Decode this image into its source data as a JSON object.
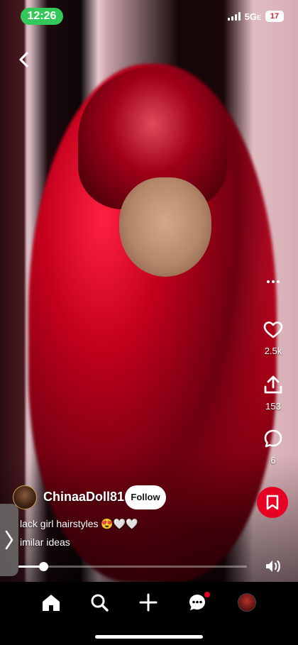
{
  "status_bar": {
    "time": "12:26",
    "network": "5G",
    "network_suffix": "E",
    "battery": "17",
    "time_color": "#34c759"
  },
  "pin": {
    "creator_name": "ChinaaDoll81",
    "follow_label": "Follow",
    "caption": "lack girl hairstyles 😍🤍🤍",
    "similar_ideas_label": "imilar ideas",
    "likes_count": "2.5k",
    "shares_count": "153",
    "comments_count": "6",
    "video_progress": 0.11
  },
  "icons": {
    "back": "chevron-left-icon",
    "more": "more-horizontal-icon",
    "like": "heart-icon",
    "share": "share-icon",
    "comment": "comment-icon",
    "save": "bookmark-icon",
    "volume": "volume-icon",
    "drawer": "chevron-right-icon"
  },
  "bottom_nav": {
    "items": [
      "home-icon",
      "search-icon",
      "plus-icon",
      "messages-icon",
      "profile-avatar"
    ],
    "messages_has_notification": true
  },
  "colors": {
    "brand": "#e60023",
    "background": "#000000",
    "text": "#ffffff"
  }
}
